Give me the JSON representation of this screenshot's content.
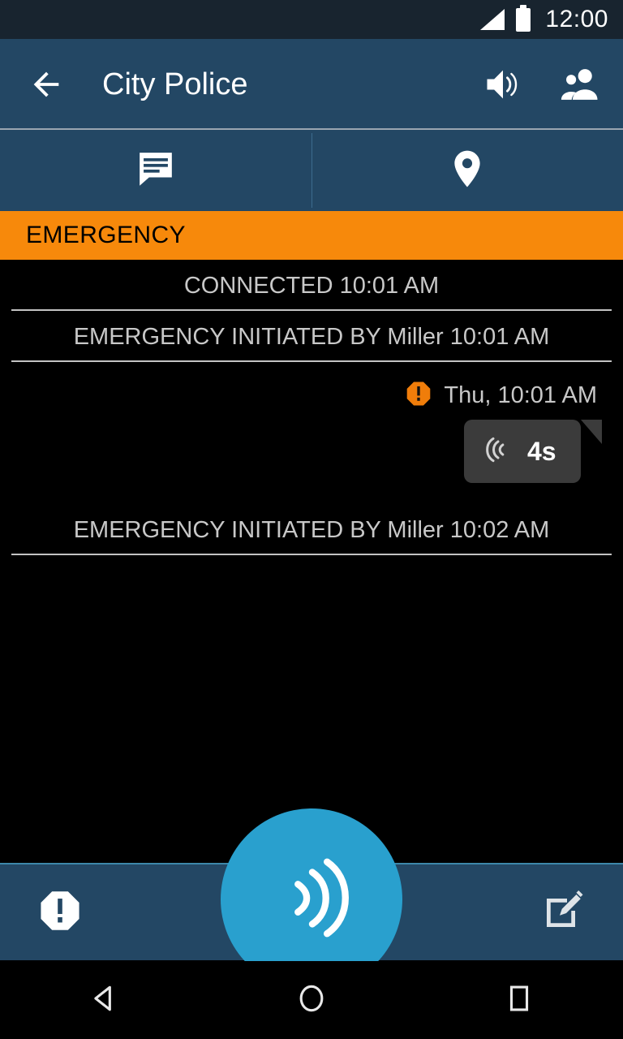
{
  "status_bar": {
    "time": "12:00",
    "signal_icon": "signal-bars-icon",
    "battery_icon": "battery-full-icon",
    "background": "#18242F"
  },
  "app_bar": {
    "back_icon": "back-arrow-icon",
    "title": "City Police",
    "speaker_icon": "speaker-volume-icon",
    "contacts_icon": "people-group-icon",
    "background": "#234764"
  },
  "tabs": [
    {
      "name": "chat-tab",
      "icon": "chat-bubble-icon",
      "selected": true
    },
    {
      "name": "location-tab",
      "icon": "location-pin-icon",
      "selected": false
    }
  ],
  "banner": {
    "label": "EMERGENCY",
    "background": "#F7890B",
    "text_color": "#000000"
  },
  "messages": [
    {
      "type": "system",
      "text": "CONNECTED 10:01 AM"
    },
    {
      "type": "system",
      "text": "EMERGENCY INITIATED BY Miller 10:01 AM"
    },
    {
      "type": "stamp",
      "icon": "emergency-octagon-icon",
      "text": "Thu, 10:01 AM"
    },
    {
      "type": "voice",
      "icon": "sound-waves-icon",
      "duration": "4s"
    },
    {
      "type": "system",
      "text": "EMERGENCY INITIATED BY Miller 10:02 AM"
    }
  ],
  "bottom_bar": {
    "emergency_icon": "emergency-octagon-icon",
    "ptt_icon": "ptt-sound-waves-icon",
    "compose_icon": "compose-edit-icon",
    "ptt_color": "#29A0CE",
    "background": "#234764"
  },
  "nav_bar": {
    "back_icon": "nav-back-triangle-icon",
    "home_icon": "nav-home-circle-icon",
    "recents_icon": "nav-recents-square-icon"
  }
}
